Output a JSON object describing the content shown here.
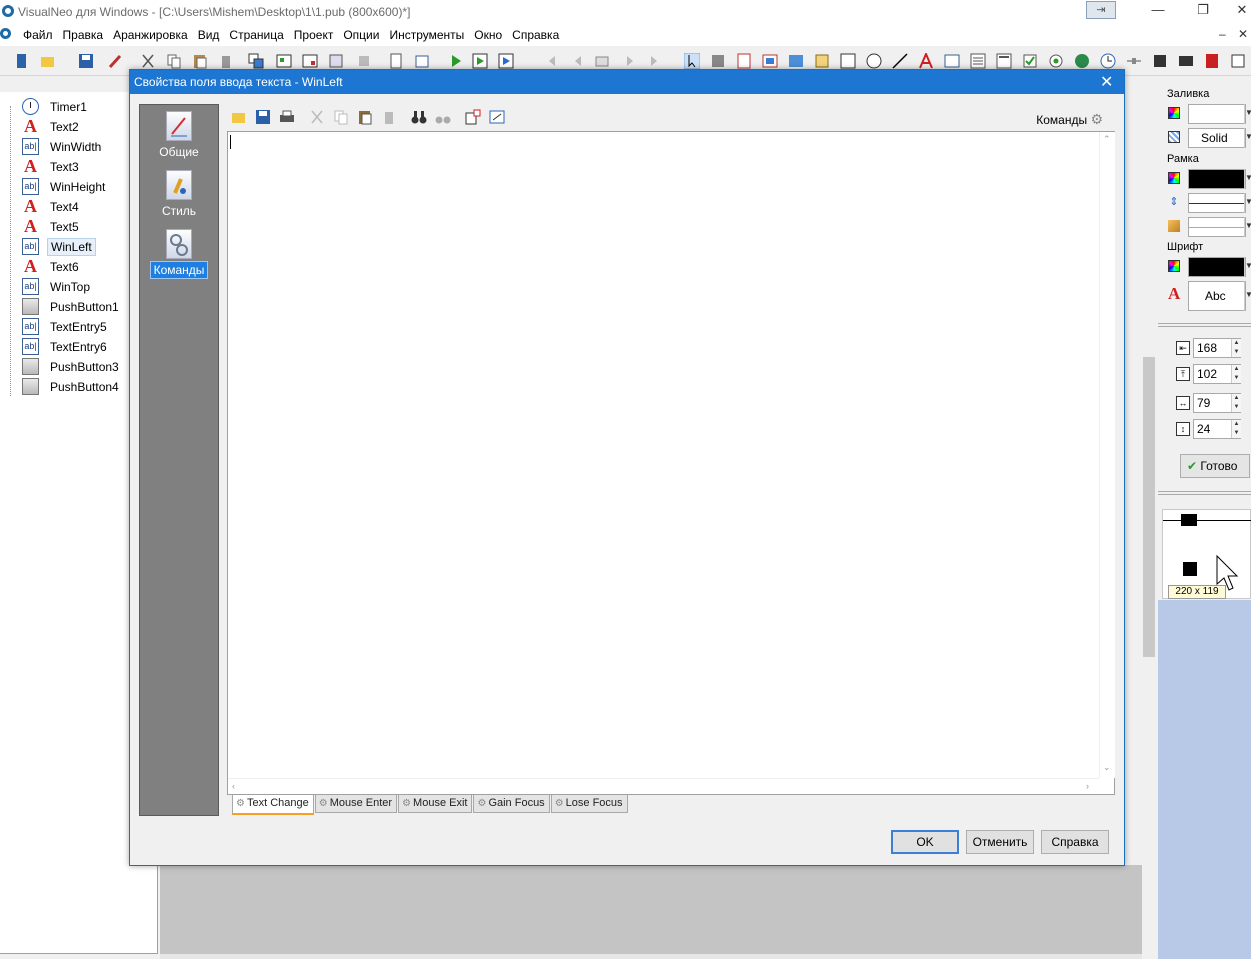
{
  "window": {
    "title": "VisualNeo для Windows - [C:\\Users\\Mishem\\Desktop\\1\\1.pub (800x600)*]",
    "pin_glyph": "⇥",
    "minimize": "—",
    "restore": "❐",
    "close": "✕"
  },
  "menu": {
    "items": [
      "Файл",
      "Правка",
      "Аранжировка",
      "Вид",
      "Страница",
      "Проект",
      "Опции",
      "Инструменты",
      "Окно",
      "Справка"
    ],
    "mdi_minimize": "–",
    "mdi_close": "✕"
  },
  "tree": {
    "items": [
      {
        "label": "Timer1",
        "icon": "timer-icon"
      },
      {
        "label": "Text2",
        "icon": "text-icon"
      },
      {
        "label": "WinWidth",
        "icon": "text-entry-icon"
      },
      {
        "label": "Text3",
        "icon": "text-icon"
      },
      {
        "label": "WinHeight",
        "icon": "text-entry-icon"
      },
      {
        "label": "Text4",
        "icon": "text-icon"
      },
      {
        "label": "Text5",
        "icon": "text-icon"
      },
      {
        "label": "WinLeft",
        "icon": "text-entry-icon",
        "selected": true
      },
      {
        "label": "Text6",
        "icon": "text-icon"
      },
      {
        "label": "WinTop",
        "icon": "text-entry-icon"
      },
      {
        "label": "PushButton1",
        "icon": "push-button-icon"
      },
      {
        "label": "TextEntry5",
        "icon": "text-entry-icon"
      },
      {
        "label": "TextEntry6",
        "icon": "text-entry-icon"
      },
      {
        "label": "PushButton3",
        "icon": "push-button-icon"
      },
      {
        "label": "PushButton4",
        "icon": "push-button-icon"
      }
    ],
    "icon_glyphs": {
      "text": "A",
      "entry": "ab|"
    }
  },
  "right_panel": {
    "fill_label": "Заливка",
    "fill_style": "Solid",
    "border_label": "Рамка",
    "font_label": "Шрифт",
    "font_sample": "Abc",
    "font_icon_glyph": "A",
    "left": "168",
    "top": "102",
    "width": "79",
    "height": "24",
    "done_label": "Готово",
    "done_glyph": "✔",
    "preview_size": "220 x 119"
  },
  "dialog": {
    "title": "Свойства поля ввода текста - WinLeft",
    "close": "✕",
    "side": [
      {
        "label": "Общие"
      },
      {
        "label": "Стиль"
      },
      {
        "label": "Команды",
        "active": true
      }
    ],
    "commands_label": "Команды",
    "gear_glyph": "⚙",
    "tabs": [
      "Text Change",
      "Mouse Enter",
      "Mouse Exit",
      "Gain Focus",
      "Lose Focus"
    ],
    "ok": "OK",
    "cancel": "Отменить",
    "help": "Справка",
    "scroll_glyphs": {
      "up": "⌃",
      "down": "⌄",
      "left": "‹",
      "right": "›"
    }
  },
  "colors": {
    "dialog_title": "#1c76d2",
    "text_icon": "#d02020",
    "tab_active": "#f5a020"
  }
}
